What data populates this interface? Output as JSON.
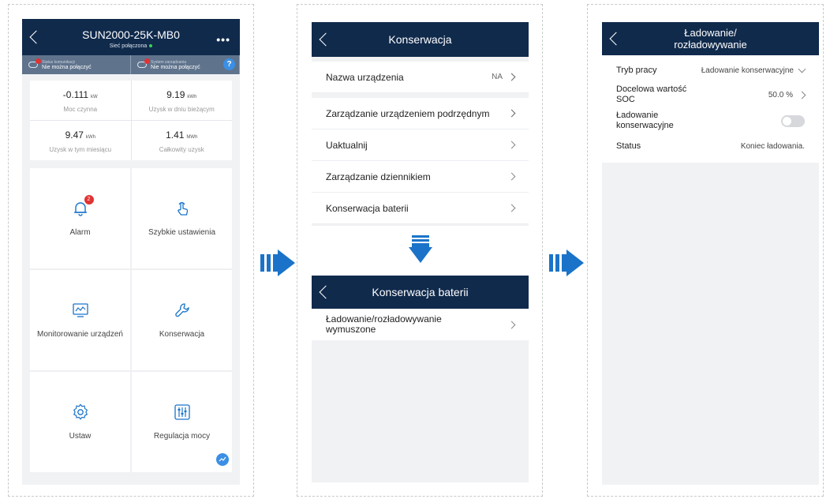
{
  "screen1": {
    "title": "SUN2000-25K-MB0",
    "subtitle": "Sieć połączona",
    "status": [
      {
        "label": "Status komunikacji",
        "value": "Nie można połączyć"
      },
      {
        "label": "System zarządzania",
        "value": "Nie można połączyć"
      }
    ],
    "help": "?",
    "kpis": [
      {
        "value": "-0.111",
        "unit": "kW",
        "name": "Moc czynna"
      },
      {
        "value": "9.19",
        "unit": "kWh",
        "name": "Uzysk w dniu bieżącym"
      },
      {
        "value": "9.47",
        "unit": "kWh",
        "name": "Uzysk w tym miesiącu"
      },
      {
        "value": "1.41",
        "unit": "MWh",
        "name": "Całkowity uzysk"
      }
    ],
    "tiles": [
      {
        "label": "Alarm",
        "badge": "2",
        "icon": "bell-icon"
      },
      {
        "label": "Szybkie ustawienia",
        "icon": "hand-pointer-icon"
      },
      {
        "label": "Monitorowanie urządzeń",
        "icon": "monitor-icon"
      },
      {
        "label": "Konserwacja",
        "icon": "wrench-icon"
      },
      {
        "label": "Ustaw",
        "icon": "gear-icon"
      },
      {
        "label": "Regulacja mocy",
        "icon": "sliders-icon"
      }
    ]
  },
  "screen2": {
    "title": "Konserwacja",
    "items": [
      {
        "label": "Nazwa urządzenia",
        "value": "NA"
      },
      {
        "label": "Zarządzanie urządzeniem podrzędnym"
      },
      {
        "label": "Uaktualnij"
      },
      {
        "label": "Zarządzanie dziennikiem"
      },
      {
        "label": "Konserwacja baterii"
      }
    ],
    "sub_title": "Konserwacja baterii",
    "sub_items": [
      {
        "label": "Ładowanie/rozładowywanie wymuszone"
      }
    ]
  },
  "screen3": {
    "title_line1": "Ładowanie/",
    "title_line2": "rozładowywanie",
    "rows": [
      {
        "label": "Tryb pracy",
        "value": "Ładowanie konserwacyjne"
      },
      {
        "label_line1": "Docelowa wartość",
        "label_line2": "SOC",
        "value": "50.0 %"
      },
      {
        "label_line1": "Ładowanie",
        "label_line2": "konserwacyjne"
      },
      {
        "label": "Status",
        "value": "Koniec ładowania."
      }
    ]
  },
  "colors": {
    "navbar": "#102a4c",
    "accent": "#1a73c9",
    "error": "#e03333"
  }
}
